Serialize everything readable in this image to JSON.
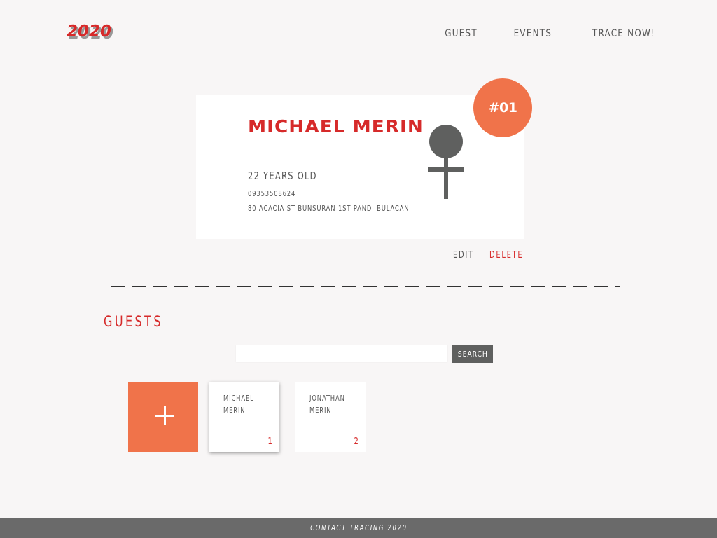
{
  "header": {
    "logo": "2020",
    "nav": [
      "GUEST",
      "EVENTS",
      "TRACE NOW!"
    ]
  },
  "profile": {
    "badge": "#01",
    "name": "MICHAEL MERIN",
    "age": "22 YEARS OLD",
    "phone": "09353508624",
    "address": "80 ACACIA ST BUNSURAN 1ST PANDI BULACAN",
    "gender_icon": "female-symbol-icon",
    "edit_label": "EDIT",
    "delete_label": "DELETE"
  },
  "guests": {
    "title": "GUESTS",
    "search_placeholder": "",
    "search_button": "SEARCH",
    "add_icon": "plus-icon",
    "items": [
      {
        "name": "MICHAEL MERIN",
        "number": "1"
      },
      {
        "name": "JONATHAN MERIN",
        "number": "2"
      }
    ]
  },
  "footer": {
    "text": "CONTACT TRACING 2020"
  },
  "colors": {
    "accent_red": "#d62a2a",
    "accent_orange": "#f0734a",
    "text_gray": "#555555",
    "footer_gray": "#6a6a6a",
    "background": "#f8f6f6"
  }
}
